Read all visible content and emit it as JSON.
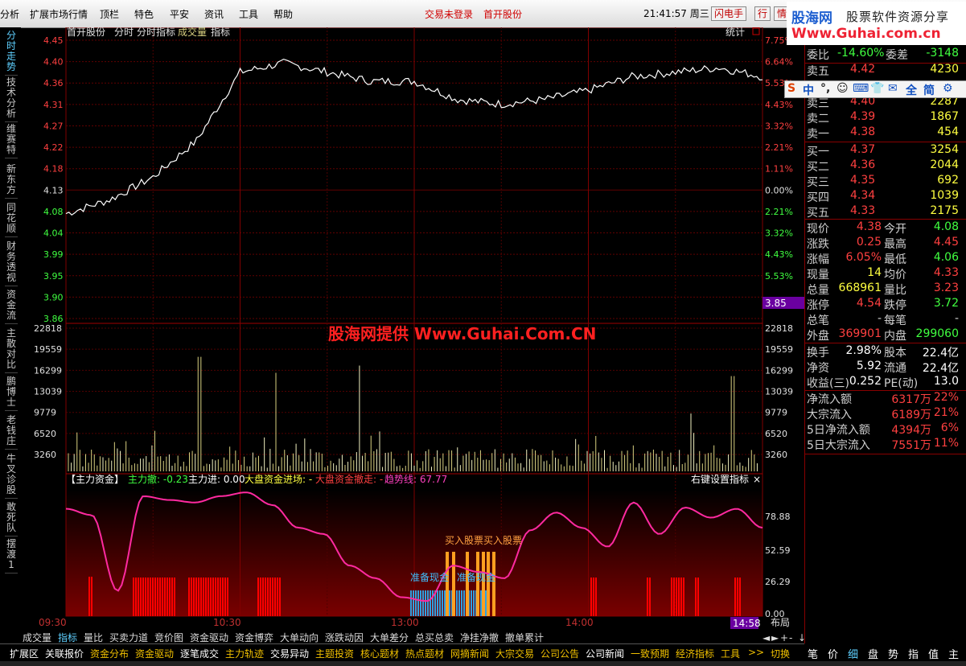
{
  "menubar": {
    "items": [
      "分析",
      "扩展市场行情",
      "顶栏",
      "特色",
      "平安",
      "资讯",
      "工具",
      "帮助"
    ],
    "login": "交易未登录",
    "stock_title": "首开股份",
    "clock": "21:41:57 周三",
    "btn_flash": "闪电手",
    "btn_hang": "行",
    "btn_qing": "情"
  },
  "watermark_logo": {
    "l1": "股海网",
    "l1b": "股票软件资源分享",
    "l2": "Www.Guhai.com.cn"
  },
  "ime": {
    "items": [
      "S",
      "中",
      "°,",
      "☺",
      "⌨",
      "👕",
      "✉",
      "全",
      "简",
      "⚙"
    ]
  },
  "left_tabs": [
    "分时走势",
    "技术分析",
    "维赛特",
    "新东方",
    "同花顺",
    "财务透视",
    "资金流",
    "主散对比",
    "鹏博士",
    "老钱庄",
    "牛叉诊股",
    "敢死队",
    "摆渡1"
  ],
  "header": {
    "stock": "首开股份",
    "t1": "分时",
    "t2": "分时指标",
    "t3": "成交量",
    "t4": "指标",
    "stat": "统计"
  },
  "price_axis": {
    "left": [
      "4.45",
      "4.40",
      "4.36",
      "4.31",
      "4.27",
      "4.22",
      "4.18",
      "4.13",
      "4.08",
      "4.04",
      "3.99",
      "3.95",
      "3.90",
      "3.86"
    ],
    "right": [
      "7.75%",
      "6.64%",
      "5.53%",
      "4.43%",
      "3.32%",
      "2.21%",
      "1.11%",
      "0.00%",
      "2.21%",
      "3.32%",
      "4.43%",
      "5.53%"
    ],
    "cursor_price": "3.85"
  },
  "vol_axis": [
    "22818",
    "19559",
    "16299",
    "13039",
    "9779",
    "6520",
    "3260"
  ],
  "watermark_center": "股海网提供 Www.Guhai.Com.CN",
  "indicator": {
    "name": "【主力资金】",
    "main_out": "主力撤: -0.23",
    "main_in": "主力进: 0.00",
    "big_in": "大盘资金进场: -",
    "big_out": "大盘资金撤走: -",
    "trend": "趋势线: 67.77",
    "setting": "右键设置指标",
    "axis": [
      "78.88",
      "52.59",
      "26.29",
      "0.00"
    ],
    "label_buy": "买入股票买入股票",
    "label_prep1": "准备现金",
    "label_prep2": "准备现金"
  },
  "time_axis": {
    "labels": [
      "09:30",
      "10:30",
      "13:00",
      "14:00"
    ],
    "cursor": "14:58",
    "layout": "布局"
  },
  "chart_data": {
    "type": "line",
    "title": "首开股份 分时走势",
    "price": {
      "x": [
        "09:30",
        "09:45",
        "10:00",
        "10:15",
        "10:30",
        "10:45",
        "11:00",
        "11:15",
        "11:30",
        "13:15",
        "13:30",
        "13:45",
        "14:00",
        "14:15",
        "14:30",
        "14:45",
        "15:00"
      ],
      "values": [
        4.08,
        4.11,
        4.16,
        4.24,
        4.39,
        4.41,
        4.39,
        4.37,
        4.37,
        4.33,
        4.32,
        4.33,
        4.35,
        4.38,
        4.39,
        4.4,
        4.38
      ],
      "ylim": [
        3.85,
        4.46
      ],
      "prev_close": 4.13
    },
    "volume": {
      "ylim": [
        0,
        26000
      ],
      "peaks": [
        20800,
        17900,
        19200,
        10500,
        17300
      ]
    },
    "indicator_trend": {
      "name": "趋势线",
      "values": [
        85,
        80,
        20,
        95,
        92,
        90,
        95,
        98,
        88,
        70,
        65,
        40,
        30,
        15,
        12,
        40,
        35,
        30,
        68,
        82,
        70,
        55,
        90,
        65,
        86,
        78,
        85,
        70
      ],
      "ylim": [
        0,
        100
      ]
    }
  },
  "quote": {
    "weibi": {
      "label": "委比",
      "value": "-14.60%",
      "label2": "委差",
      "value2": "-3148"
    },
    "sell": [
      {
        "label": "卖五",
        "price": "4.42",
        "vol": "4230"
      },
      {
        "label": "卖三",
        "price": "4.40",
        "vol": "2287"
      },
      {
        "label": "卖二",
        "price": "4.39",
        "vol": "1867"
      },
      {
        "label": "卖一",
        "price": "4.38",
        "vol": "454"
      }
    ],
    "buy": [
      {
        "label": "买一",
        "price": "4.37",
        "vol": "3254"
      },
      {
        "label": "买二",
        "price": "4.36",
        "vol": "2044"
      },
      {
        "label": "买三",
        "price": "4.35",
        "vol": "692"
      },
      {
        "label": "买四",
        "price": "4.34",
        "vol": "1039"
      },
      {
        "label": "买五",
        "price": "4.33",
        "vol": "2175"
      }
    ],
    "stats": [
      {
        "l1": "现价",
        "v1": "4.38",
        "l2": "今开",
        "v2": "4.08",
        "c1": "#ff4040",
        "c2": "#40ff40"
      },
      {
        "l1": "涨跌",
        "v1": "0.25",
        "l2": "最高",
        "v2": "4.45",
        "c1": "#ff4040",
        "c2": "#ff4040"
      },
      {
        "l1": "涨幅",
        "v1": "6.05%",
        "l2": "最低",
        "v2": "4.06",
        "c1": "#ff4040",
        "c2": "#40ff40"
      },
      {
        "l1": "现量",
        "v1": "14",
        "l2": "均价",
        "v2": "4.33",
        "c1": "#ffff40",
        "c2": "#ff4040"
      },
      {
        "l1": "总量",
        "v1": "668961",
        "l2": "量比",
        "v2": "3.23",
        "c1": "#ffff40",
        "c2": "#ff4040"
      },
      {
        "l1": "涨停",
        "v1": "4.54",
        "l2": "跌停",
        "v2": "3.72",
        "c1": "#ff4040",
        "c2": "#40ff40"
      },
      {
        "l1": "总笔",
        "v1": "-",
        "l2": "每笔",
        "v2": "-",
        "c1": "#d0d0d0",
        "c2": "#d0d0d0"
      },
      {
        "l1": "外盘",
        "v1": "369901",
        "l2": "内盘",
        "v2": "299060",
        "c1": "#ff4040",
        "c2": "#40ff40"
      }
    ],
    "stats2": [
      {
        "l1": "换手",
        "v1": "2.98%",
        "l2": "股本",
        "v2": "22.4亿"
      },
      {
        "l1": "净资",
        "v1": "5.92",
        "l2": "流通",
        "v2": "22.4亿"
      },
      {
        "l1": "收益(三)",
        "v1": "0.252",
        "l2": "PE(动)",
        "v2": "13.0"
      }
    ],
    "flow": [
      {
        "label": "净流入额",
        "value": "6317万",
        "pct": "22%"
      },
      {
        "label": "大宗流入",
        "value": "6189万",
        "pct": "21%"
      },
      {
        "label": "5日净流入额",
        "value": "4394万",
        "pct": "6%"
      },
      {
        "label": "5日大宗流入",
        "value": "7551万",
        "pct": "11%"
      }
    ]
  },
  "bottom_tabs": [
    "成交量",
    "指标",
    "量比",
    "买卖力道",
    "竞价图",
    "资金驱动",
    "资金博弈",
    "大单动向",
    "涨跌动因",
    "大单差分",
    "总买总卖",
    "净挂净撤",
    "撤单累计"
  ],
  "nav_arrows": [
    "◄",
    "►",
    "+",
    "-",
    "↓"
  ],
  "bar2": [
    "扩展区",
    "关联报价",
    "资金分布",
    "资金驱动",
    "逐笔成交",
    "主力轨迹",
    "交易异动",
    "主题投资",
    "核心题材",
    "热点题材",
    "网摘新闻",
    "大宗交易",
    "公司公告",
    "公司新闻",
    "一致预期",
    "经济指标",
    "工具",
    ">>",
    "切换"
  ],
  "right_tabs": [
    "笔",
    "价",
    "细",
    "盘",
    "势",
    "指",
    "值",
    "主"
  ]
}
